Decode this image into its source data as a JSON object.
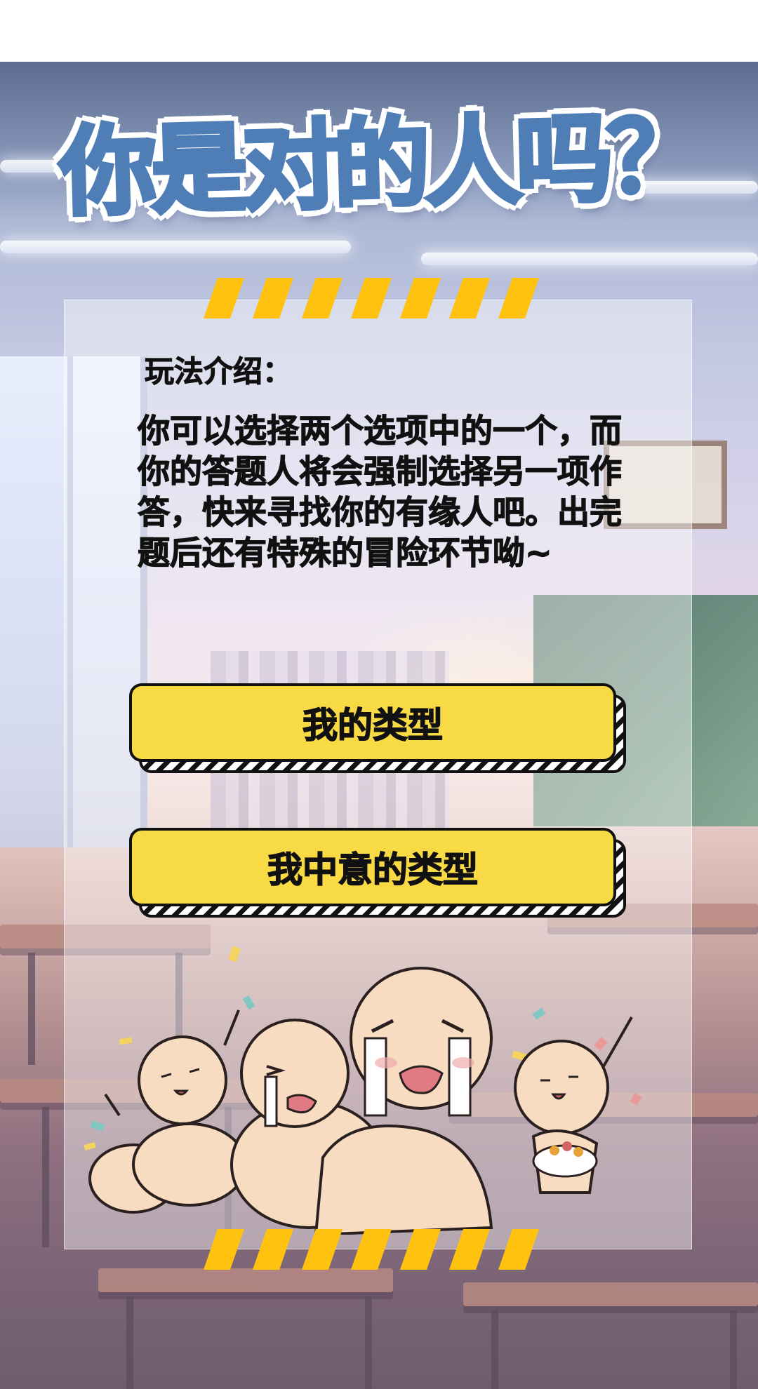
{
  "title": "你是对的人吗？",
  "intro": {
    "heading": "玩法介绍：",
    "body": "你可以选择两个选项中的一个，而你的答题人将会强制选择另一项作答，快来寻找你的有缘人吧。出完题后还有特殊的冒险环节呦~"
  },
  "buttons": {
    "my_type": "我的类型",
    "preferred_type": "我中意的类型"
  },
  "colors": {
    "title": "#4f7db5",
    "button_fill": "#f8da45",
    "stripe_yellow": "#ffc20e",
    "outline": "#111111"
  },
  "icons": {
    "illustration": "celebrating-cartoon-characters",
    "decoration": "hazard-stripes"
  }
}
